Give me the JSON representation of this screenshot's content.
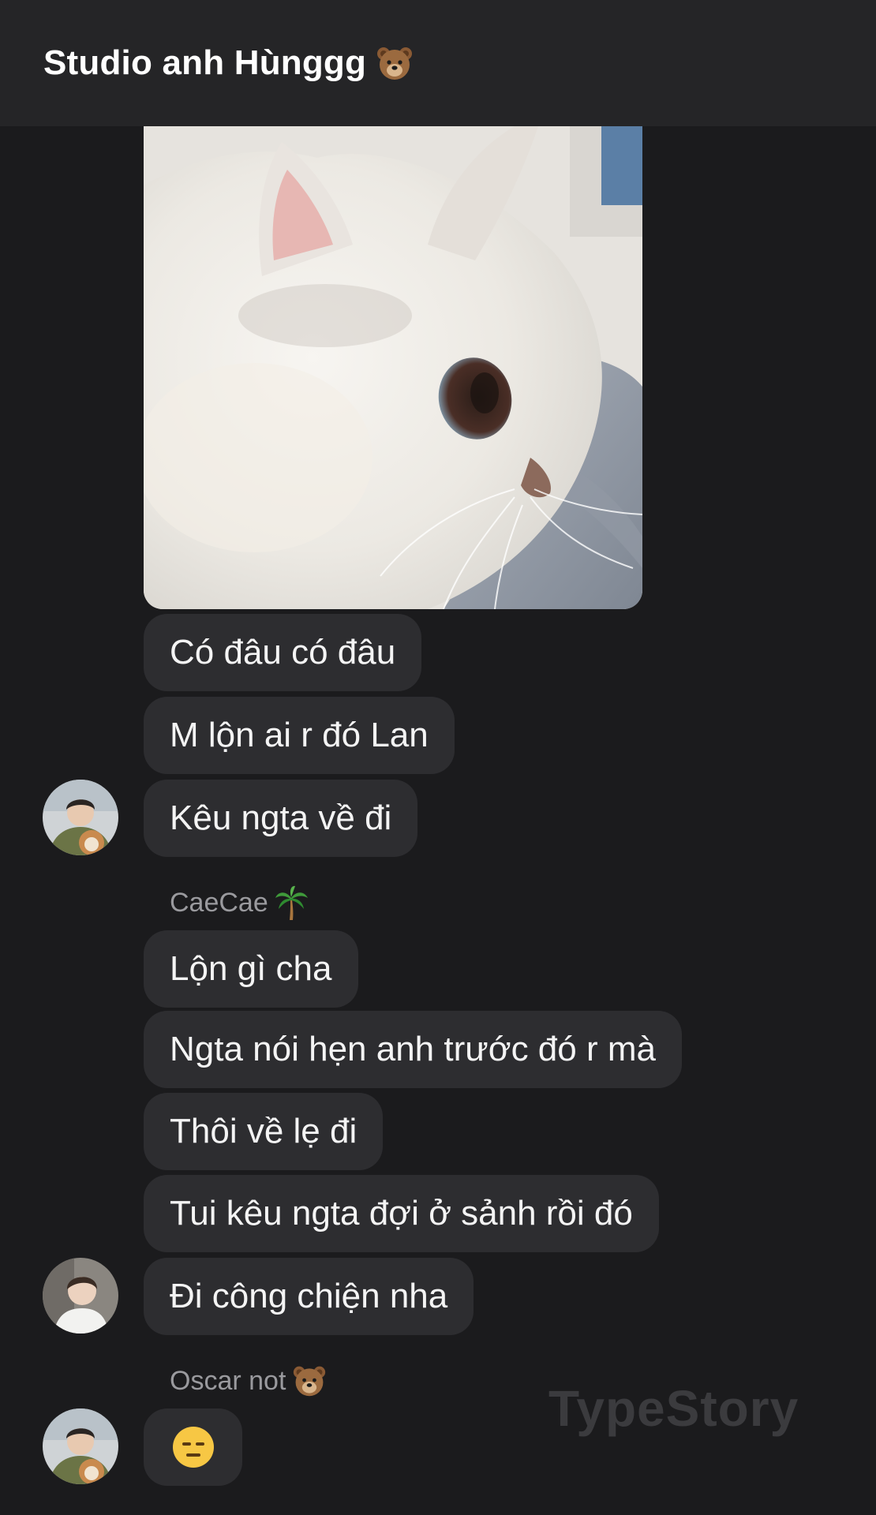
{
  "header": {
    "title": "Studio anh Hùnggg",
    "title_emoji": "bear-face-emoji"
  },
  "messages": [
    {
      "text": "Có đâu có đâu"
    },
    {
      "text": "M lộn ai r đó Lan"
    },
    {
      "text": "Kêu ngta về đi"
    },
    {
      "text": "Lộn gì cha"
    },
    {
      "text": "Ngta nói hẹn anh trước đó r mà"
    },
    {
      "text": "Thôi về lẹ đi"
    },
    {
      "text": "Tui kêu ngta đợi ở sảnh rồi đó"
    },
    {
      "text": "Đi công chiện nha"
    },
    {
      "emoji": "expressionless-face-emoji"
    }
  ],
  "senders": {
    "caecae": {
      "name": "CaeCae",
      "emoji": "palm-tree-emoji"
    },
    "oscar": {
      "name": "Oscar not",
      "emoji": "bear-face-emoji"
    }
  },
  "watermark": "TypeStory",
  "colors": {
    "background": "#1b1b1d",
    "header": "#252527",
    "bubble": "#2d2d30",
    "sender_name": "#9a9a9e"
  }
}
